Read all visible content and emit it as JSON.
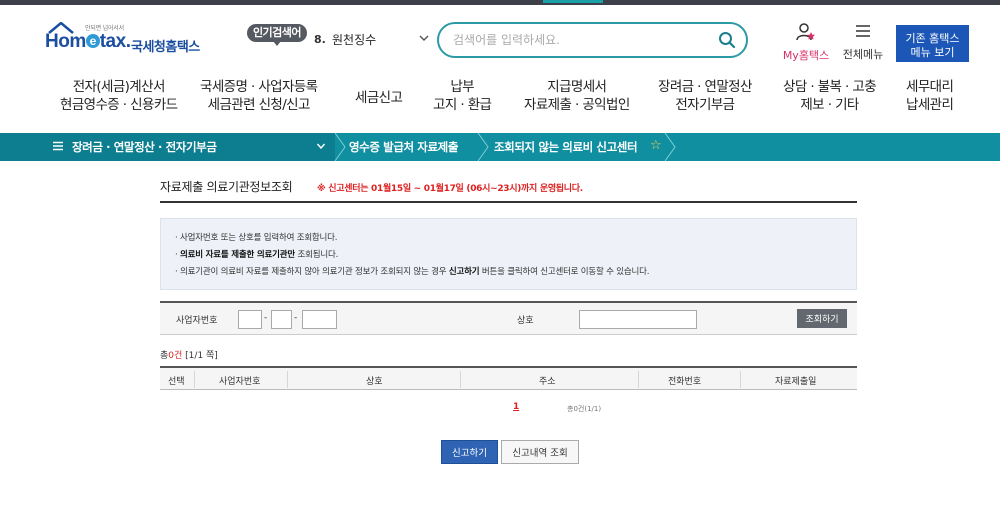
{
  "header": {
    "logo_tagline": "안되면 넘어서서",
    "logo_wordmark_a": "Hom",
    "logo_wordmark_e": "e",
    "logo_wordmark_b": "tax.",
    "logo_korean": "국세청홈택스",
    "popular_label": "인기검색어",
    "popular_rank": "8.",
    "popular_term": "원천징수",
    "search_placeholder": "검색어를 입력하세요.",
    "my_label": "My홈택스",
    "allmenu_label": "전체메뉴",
    "old_menu_line1": "기존 홈택스",
    "old_menu_line2": "메뉴 보기"
  },
  "gnb": [
    {
      "line1": "전자(세금)계산서",
      "line2": "현금영수증 · 신용카드"
    },
    {
      "line1": "국세증명 · 사업자등록",
      "line2": "세금관련 신청/신고"
    },
    {
      "line1": "세금신고",
      "line2": ""
    },
    {
      "line1": "납부",
      "line2": "고지 · 환급"
    },
    {
      "line1": "지급명세서",
      "line2": "자료제출 · 공익법인"
    },
    {
      "line1": "장려금 · 연말정산",
      "line2": "전자기부금"
    },
    {
      "line1": "상담 · 불복 · 고충",
      "line2": "제보 · 기타"
    },
    {
      "line1": "세무대리",
      "line2": "납세관리"
    }
  ],
  "navbar": {
    "menu": "장려금 · 연말정산 · 전자기부금",
    "crumb1": "영수증 발급처 자료제출",
    "crumb2": "조회되지 않는 의료비 신고센터",
    "star": "☆",
    "accent": "#108fa0"
  },
  "page": {
    "title": "자료제출 의료기관정보조회",
    "notice": "※ 신고센터는 01월15일 ~ 01월17일 (06시~23시)까지 운영됩니다.",
    "info_line1": "· 사업자번호 또는 상호를 입력하여 조회합니다.",
    "info_line2_bold": "의료비 자료를 제출한 의료기관만",
    "info_line2_rest": " 조회됩니다.",
    "info_line2_prefix": "· ",
    "info_line3_a": "· 의료기관이 의료비 자료를 제출하지 않아 의료기관 정보가 조회되지 않는 경우 ",
    "info_line3_bold": "신고하기",
    "info_line3_b": " 버튼을 클릭하여 신고센터로 이동할 수 있습니다.",
    "bizno_label": "사업자번호",
    "dash": "-",
    "name_label": "상호",
    "search_button": "조회하기",
    "count_prefix": "총",
    "count_num": "0건",
    "count_page": "[1/1 쪽]",
    "columns": [
      "선택",
      "사업자번호",
      "상호",
      "주소",
      "전화번호",
      "자료제출일"
    ],
    "pager_current": "1",
    "pager_total": "총0건(1/1)",
    "report_button": "신고하기",
    "history_button": "신고내역 조회"
  }
}
